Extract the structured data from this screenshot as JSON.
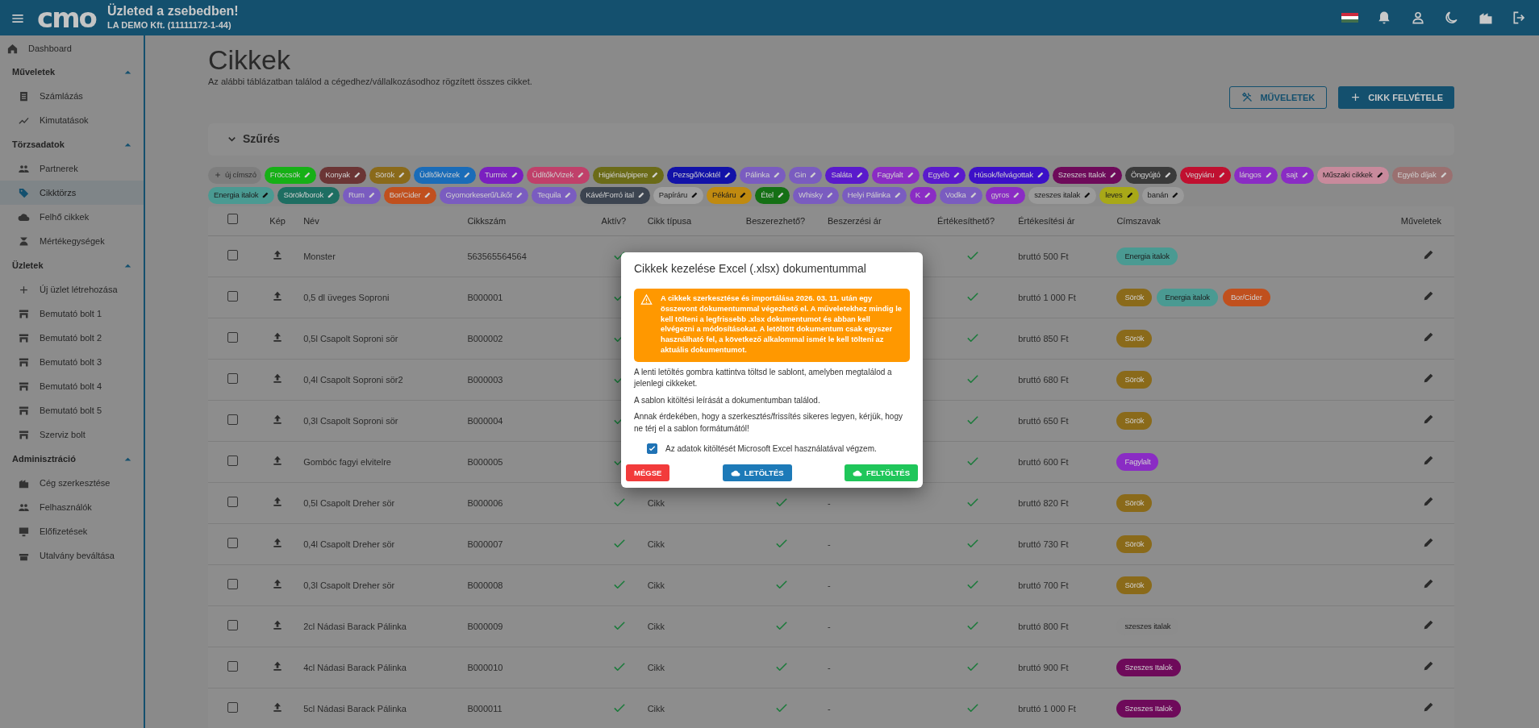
{
  "header": {
    "logo": "cmo",
    "title": "Üzleted a zsebedben!",
    "subtitle": "LA DEMO Kft. (11111172-1-44)"
  },
  "sidebar": {
    "top_item": {
      "label": "Dashboard",
      "selected": false
    },
    "sections": [
      {
        "label": "Műveletek",
        "expanded": true,
        "items": [
          {
            "label": "Számlázás",
            "selected": false
          },
          {
            "label": "Kimutatások",
            "selected": false
          }
        ]
      },
      {
        "label": "Törzsadatok",
        "expanded": true,
        "items": [
          {
            "label": "Partnerek",
            "selected": false
          },
          {
            "label": "Cikktörzs",
            "selected": true
          },
          {
            "label": "Felhő cikkek",
            "selected": false
          },
          {
            "label": "Mértékegységek",
            "selected": false
          }
        ]
      },
      {
        "label": "Üzletek",
        "expanded": true,
        "items": [
          {
            "label": "Új üzlet létrehozása",
            "selected": false
          },
          {
            "label": "Bemutató bolt 1",
            "selected": false
          },
          {
            "label": "Bemutató bolt 2",
            "selected": false
          },
          {
            "label": "Bemutató bolt 3",
            "selected": false
          },
          {
            "label": "Bemutató bolt 4",
            "selected": false
          },
          {
            "label": "Bemutató bolt 5",
            "selected": false
          },
          {
            "label": "Szerviz bolt",
            "selected": false
          }
        ]
      },
      {
        "label": "Adminisztráció",
        "expanded": true,
        "items": [
          {
            "label": "Cég szerkesztése",
            "selected": false
          },
          {
            "label": "Felhasználók",
            "selected": false
          },
          {
            "label": "Előfizetések",
            "selected": false
          },
          {
            "label": "Utalvány beváltása",
            "selected": false
          }
        ]
      }
    ]
  },
  "page": {
    "title": "Cikkek",
    "subtitle": "Az alábbi táblázatban találod a cégedhez/vállalkozásodhoz rögzített összes cikket.",
    "buttons": [
      {
        "label": "MŰVELETEK",
        "kind": "outline"
      },
      {
        "label": "CIKK FELVÉTELE",
        "kind": "primary"
      }
    ]
  },
  "filter": {
    "label": "Szűrés",
    "expanded": false
  },
  "tags": {
    "add_label": "új címszó",
    "items": [
      {
        "label": "Fröccsök",
        "color": "#16b016"
      },
      {
        "label": "Konyak",
        "color": "#6b3535"
      },
      {
        "label": "Sörök",
        "color": "#8a6a1a"
      },
      {
        "label": "Üdítők/vizek",
        "color": "#1a6cb8"
      },
      {
        "label": "Turmix",
        "color": "#7a1fc0"
      },
      {
        "label": "Üdítők/Vizek",
        "color": "#c0406a"
      },
      {
        "label": "Higiénia/pipere",
        "color": "#6b6b18"
      },
      {
        "label": "Pezsgő/Koktél",
        "color": "#1212a8"
      },
      {
        "label": "Pálinka",
        "color": "#7a5cc0"
      },
      {
        "label": "Gin",
        "color": "#7a5cc0"
      },
      {
        "label": "Saláta",
        "color": "#5a1acc"
      },
      {
        "label": "Fagylalt",
        "color": "#8a2cc4"
      },
      {
        "label": "Egyéb",
        "color": "#5a1acc"
      },
      {
        "label": "Húsok/felvágottak",
        "color": "#3c10c8"
      },
      {
        "label": "Szeszes Italok",
        "color": "#6e0a5a"
      },
      {
        "label": "Öngyújtó",
        "color": "#3a3a3a"
      },
      {
        "label": "Vegyiáru",
        "color": "#c01030"
      },
      {
        "label": "lángos",
        "color": "#8a2cc4"
      },
      {
        "label": "sajt",
        "color": "#8a2cc4"
      },
      {
        "label": "Műszaki cikkek",
        "color": "#c88a9c"
      },
      {
        "label": "Egyéb díjak",
        "color": "#9a7070"
      },
      {
        "label": "Energia italok",
        "color": "#4a9a92"
      },
      {
        "label": "Sörök/borok",
        "color": "#1e6e62"
      },
      {
        "label": "Rum",
        "color": "#7a5cc0"
      },
      {
        "label": "Bor/Cider",
        "color": "#c0501e"
      },
      {
        "label": "Gyomorkeserű/Likőr",
        "color": "#7a5cc0"
      },
      {
        "label": "Tequila",
        "color": "#7a5cc0"
      },
      {
        "label": "Kávé/Forró ital",
        "color": "#3c4450"
      },
      {
        "label": "Papíráru",
        "color": "#a0a0a0"
      },
      {
        "label": "Pékáru",
        "color": "#c08a10"
      },
      {
        "label": "Étel",
        "color": "#157015"
      },
      {
        "label": "Whisky",
        "color": "#7a5cc0"
      },
      {
        "label": "Helyi Pálinka",
        "color": "#7a5cc0"
      },
      {
        "label": "K",
        "color": "#8a2cc4"
      },
      {
        "label": "Vodka",
        "color": "#7a5cc0"
      },
      {
        "label": "gyros",
        "color": "#8a2cc4"
      },
      {
        "label": "szeszes italak",
        "color": "#9a9a9a"
      },
      {
        "label": "leves",
        "color": "#a8a818"
      },
      {
        "label": "banán",
        "color": "#9a9a9a"
      }
    ]
  },
  "table": {
    "select_all": {
      "checked": false
    },
    "columns": [
      "Kép",
      "Név",
      "Cikkszám",
      "Aktív?",
      "Cikk típusa",
      "Beszerezhető?",
      "Beszerzési ár",
      "Értékesíthető?",
      "Értékesítési ár",
      "Címszavak",
      "Műveletek"
    ],
    "rows": [
      {
        "checked": false,
        "name": "Monster",
        "sku": "563565564564",
        "active": true,
        "sellable": true,
        "price": "bruttó 500 Ft",
        "tags": [
          {
            "label": "Energia italok",
            "color": "#4a9a92"
          }
        ]
      },
      {
        "checked": false,
        "name": "0,5 dl üveges Soproni",
        "sku": "B000001",
        "active": true,
        "sellable": true,
        "price": "bruttó 1 000 Ft",
        "tags": [
          {
            "label": "Sörök",
            "color": "#8a6a1a"
          },
          {
            "label": "Energia italok",
            "color": "#4a9a92"
          },
          {
            "label": "Bor/Cider",
            "color": "#c0501e"
          }
        ]
      },
      {
        "checked": false,
        "name": "0,5l Csapolt Soproni sör",
        "sku": "B000002",
        "active": true,
        "sellable": true,
        "price": "bruttó 850 Ft",
        "tags": [
          {
            "label": "Sörök",
            "color": "#8a6a1a"
          }
        ]
      },
      {
        "checked": false,
        "name": "0,4l Csapolt Soproni sör2",
        "sku": "B000003",
        "active": true,
        "sellable": true,
        "price": "bruttó 680 Ft",
        "tags": [
          {
            "label": "Sörök",
            "color": "#8a6a1a"
          }
        ]
      },
      {
        "checked": false,
        "name": "0,3l Csapolt Soproni sör",
        "sku": "B000004",
        "active": true,
        "sellable": true,
        "price": "bruttó 650 Ft",
        "tags": [
          {
            "label": "Sörök",
            "color": "#8a6a1a"
          }
        ]
      },
      {
        "checked": false,
        "name": "Gombóc fagyi elvitelre",
        "sku": "B000005",
        "active": true,
        "sellable": true,
        "price": "bruttó 600 Ft",
        "tags": [
          {
            "label": "Fagylalt",
            "color": "#8a2cc4"
          }
        ]
      },
      {
        "checked": false,
        "name": "0,5l Csapolt Dreher sör",
        "sku": "B000006",
        "active": true,
        "type": "Cikk",
        "purchasable": true,
        "purchase_price": "-",
        "sellable": true,
        "price": "bruttó 820 Ft",
        "tags": [
          {
            "label": "Sörök",
            "color": "#8a6a1a"
          }
        ]
      },
      {
        "checked": false,
        "name": "0,4l Csapolt Dreher sör",
        "sku": "B000007",
        "active": true,
        "type": "Cikk",
        "purchasable": true,
        "purchase_price": "-",
        "sellable": true,
        "price": "bruttó 730 Ft",
        "tags": [
          {
            "label": "Sörök",
            "color": "#8a6a1a"
          }
        ]
      },
      {
        "checked": false,
        "name": "0,3l Csapolt Dreher sör",
        "sku": "B000008",
        "active": true,
        "type": "Cikk",
        "purchasable": true,
        "purchase_price": "-",
        "sellable": true,
        "price": "bruttó 700 Ft",
        "tags": [
          {
            "label": "Sörök",
            "color": "#8a6a1a"
          }
        ]
      },
      {
        "checked": false,
        "name": "2cl Nádasi Barack Pálinka",
        "sku": "B000009",
        "active": true,
        "type": "Cikk",
        "purchasable": true,
        "purchase_price": "-",
        "sellable": true,
        "price": "bruttó 800 Ft",
        "tags": [
          {
            "label": "szeszes italak",
            "color": "#8c8c8c"
          }
        ]
      },
      {
        "checked": false,
        "name": "4cl Nádasi Barack Pálinka",
        "sku": "B000010",
        "active": true,
        "type": "Cikk",
        "purchasable": true,
        "purchase_price": "-",
        "sellable": true,
        "price": "bruttó 900 Ft",
        "tags": [
          {
            "label": "Szeszes Italok",
            "color": "#6e0a5a"
          }
        ]
      },
      {
        "checked": false,
        "name": "5cl Nádasi Barack Pálinka",
        "sku": "B000011",
        "active": true,
        "type": "Cikk",
        "purchasable": true,
        "purchase_price": "-",
        "sellable": true,
        "price": "bruttó 1 000 Ft",
        "tags": [
          {
            "label": "Szeszes Italok",
            "color": "#6e0a5a"
          }
        ]
      }
    ]
  },
  "modal": {
    "title": "Cikkek kezelése Excel (.xlsx) dokumentummal",
    "warning": "A cikkek szerkesztése és importálása 2026. 03. 11. után egy összevont dokumentummal végezhető el. A műveletekhez mindig le kell tölteni a legfrissebb .xlsx dokumentumot és abban kell elvégezni a módosításokat. A letöltött dokumentum csak egyszer használható fel, a következő alkalommal ismét le kell tölteni az aktuális dokumentumot.",
    "paragraphs": [
      "A lenti letöltés gombra kattintva töltsd le sablont, amelyben megtalálod a jelenlegi cikkeket.",
      "A sablon kitöltési leírását a dokumentumban találod.",
      "Annak érdekében, hogy a szerkesztés/frissítés sikeres legyen, kérjük, hogy ne térj el a sablon formátumától!"
    ],
    "checkbox": {
      "label": "Az adatok kitöltését Microsoft Excel használatával végzem.",
      "checked": true
    },
    "buttons": [
      {
        "label": "MÉGSE",
        "kind": "cancel"
      },
      {
        "label": "LETÖLTÉS",
        "kind": "download"
      },
      {
        "label": "FELTÖLTÉS",
        "kind": "upload"
      }
    ]
  }
}
